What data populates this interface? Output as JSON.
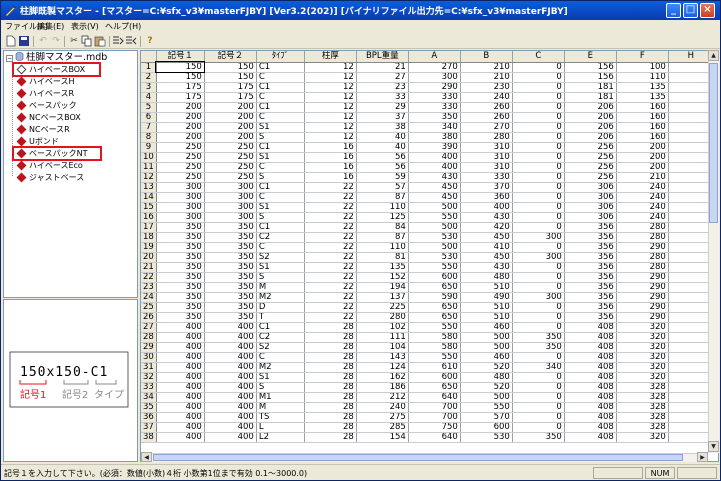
{
  "window": {
    "title": "柱脚既製マスター - [マスター=C:¥sfx_v3¥masterFJBY] [Ver3.2(202)] [バイナリファイル出力先=C:¥sfx_v3¥masterFJBY]"
  },
  "menu": [
    "ファイル(F)",
    "編集(E)",
    "表示(V)",
    "ヘルプ(H)"
  ],
  "toolbar": {
    "items": [
      "new-file",
      "save",
      "undo",
      "redo",
      "cut",
      "copy",
      "paste",
      "insert-row",
      "delete-row",
      "help"
    ]
  },
  "tree": {
    "root": "柱脚マスター.mdb",
    "items": [
      {
        "label": "ハイベースBOX",
        "selected": true,
        "highlighted": true
      },
      {
        "label": "ハイベースH",
        "highlighted": false
      },
      {
        "label": "ハイベースR",
        "highlighted": false
      },
      {
        "label": "ベースパック",
        "highlighted": false
      },
      {
        "label": "NCベースBOX",
        "highlighted": false
      },
      {
        "label": "NCベースR",
        "highlighted": false
      },
      {
        "label": "Uボンド",
        "highlighted": false
      },
      {
        "label": "ベースパックNT",
        "highlighted": true
      },
      {
        "label": "ハイベースEco",
        "highlighted": false
      },
      {
        "label": "ジャストベース",
        "highlighted": false
      }
    ]
  },
  "diagram": {
    "main_text": "150x150-C1",
    "label_1": "記号1",
    "label_2": "記号2",
    "label_3": "タイプ",
    "accent": "#e2141c"
  },
  "grid": {
    "columns": [
      "記号１",
      "記号２",
      "ﾀｲﾌﾟ",
      "柱厚",
      "BPL重量",
      "A",
      "B",
      "C",
      "E",
      "F",
      "H"
    ],
    "rows": [
      [
        "150",
        "150",
        "C1",
        "12",
        "21",
        "270",
        "210",
        "0",
        "156",
        "100"
      ],
      [
        "150",
        "150",
        "C",
        "12",
        "27",
        "300",
        "210",
        "0",
        "156",
        "110"
      ],
      [
        "175",
        "175",
        "C1",
        "12",
        "23",
        "290",
        "230",
        "0",
        "181",
        "135"
      ],
      [
        "175",
        "175",
        "C",
        "12",
        "33",
        "330",
        "240",
        "0",
        "181",
        "135"
      ],
      [
        "200",
        "200",
        "C1",
        "12",
        "29",
        "330",
        "260",
        "0",
        "206",
        "160"
      ],
      [
        "200",
        "200",
        "C",
        "12",
        "37",
        "350",
        "260",
        "0",
        "206",
        "160"
      ],
      [
        "200",
        "200",
        "S1",
        "12",
        "38",
        "340",
        "270",
        "0",
        "206",
        "160"
      ],
      [
        "200",
        "200",
        "S",
        "12",
        "40",
        "380",
        "280",
        "0",
        "206",
        "160"
      ],
      [
        "250",
        "250",
        "C1",
        "16",
        "40",
        "390",
        "310",
        "0",
        "256",
        "200"
      ],
      [
        "250",
        "250",
        "S1",
        "16",
        "56",
        "400",
        "310",
        "0",
        "256",
        "200"
      ],
      [
        "250",
        "250",
        "C",
        "16",
        "56",
        "400",
        "310",
        "0",
        "256",
        "200"
      ],
      [
        "250",
        "250",
        "S",
        "16",
        "59",
        "430",
        "330",
        "0",
        "256",
        "210"
      ],
      [
        "300",
        "300",
        "C1",
        "22",
        "57",
        "450",
        "370",
        "0",
        "306",
        "240"
      ],
      [
        "300",
        "300",
        "C",
        "22",
        "87",
        "450",
        "360",
        "0",
        "306",
        "240"
      ],
      [
        "300",
        "300",
        "S1",
        "22",
        "110",
        "500",
        "400",
        "0",
        "306",
        "240"
      ],
      [
        "300",
        "300",
        "S",
        "22",
        "125",
        "550",
        "430",
        "0",
        "306",
        "240"
      ],
      [
        "350",
        "350",
        "C1",
        "22",
        "84",
        "500",
        "420",
        "0",
        "356",
        "280"
      ],
      [
        "350",
        "350",
        "C2",
        "22",
        "87",
        "530",
        "450",
        "300",
        "356",
        "280"
      ],
      [
        "350",
        "350",
        "C",
        "22",
        "110",
        "500",
        "410",
        "0",
        "356",
        "290"
      ],
      [
        "350",
        "350",
        "S2",
        "22",
        "81",
        "530",
        "450",
        "300",
        "356",
        "280"
      ],
      [
        "350",
        "350",
        "S1",
        "22",
        "135",
        "550",
        "430",
        "0",
        "356",
        "280"
      ],
      [
        "350",
        "350",
        "S",
        "22",
        "152",
        "600",
        "480",
        "0",
        "356",
        "290"
      ],
      [
        "350",
        "350",
        "M",
        "22",
        "194",
        "650",
        "510",
        "0",
        "356",
        "290"
      ],
      [
        "350",
        "350",
        "M2",
        "22",
        "137",
        "590",
        "490",
        "300",
        "356",
        "290"
      ],
      [
        "350",
        "350",
        "D",
        "22",
        "225",
        "650",
        "510",
        "0",
        "356",
        "290"
      ],
      [
        "350",
        "350",
        "T",
        "22",
        "280",
        "650",
        "510",
        "0",
        "356",
        "290"
      ],
      [
        "400",
        "400",
        "C1",
        "28",
        "102",
        "550",
        "460",
        "0",
        "408",
        "320"
      ],
      [
        "400",
        "400",
        "C2",
        "28",
        "111",
        "580",
        "500",
        "350",
        "408",
        "320"
      ],
      [
        "400",
        "400",
        "S2",
        "28",
        "104",
        "580",
        "500",
        "350",
        "408",
        "320"
      ],
      [
        "400",
        "400",
        "C",
        "28",
        "143",
        "550",
        "460",
        "0",
        "408",
        "320"
      ],
      [
        "400",
        "400",
        "M2",
        "28",
        "124",
        "610",
        "520",
        "340",
        "408",
        "320"
      ],
      [
        "400",
        "400",
        "S1",
        "28",
        "162",
        "600",
        "480",
        "0",
        "408",
        "320"
      ],
      [
        "400",
        "400",
        "S",
        "28",
        "186",
        "650",
        "520",
        "0",
        "408",
        "328"
      ],
      [
        "400",
        "400",
        "M1",
        "28",
        "212",
        "640",
        "500",
        "0",
        "408",
        "328"
      ],
      [
        "400",
        "400",
        "M",
        "28",
        "240",
        "700",
        "550",
        "0",
        "408",
        "328"
      ],
      [
        "400",
        "400",
        "TS",
        "28",
        "275",
        "700",
        "570",
        "0",
        "408",
        "328"
      ],
      [
        "400",
        "400",
        "L",
        "28",
        "285",
        "750",
        "600",
        "0",
        "408",
        "328"
      ],
      [
        "400",
        "400",
        "L2",
        "28",
        "154",
        "640",
        "530",
        "350",
        "408",
        "320"
      ]
    ],
    "selected_row": 1
  },
  "statusbar": {
    "message": "記号１を入力して下さい。(必須：数値(小数)４桁 小数第1位まで有効 0.1～3000.0)",
    "num": "NUM"
  }
}
